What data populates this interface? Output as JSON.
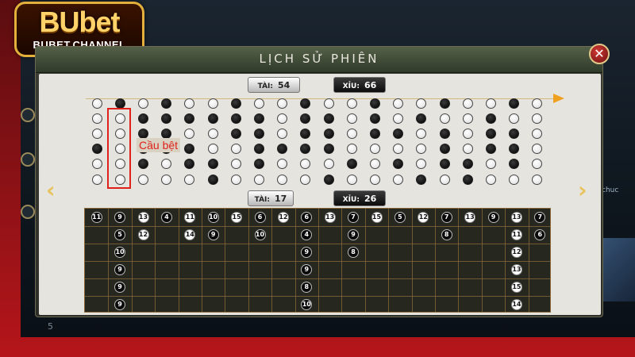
{
  "logo": {
    "main": "BUbet",
    "sub": "BUBET.CHANNEL"
  },
  "dialog": {
    "title": "LỊCH SỬ PHIÊN",
    "close_label": "✕"
  },
  "summary_top": {
    "tai_label": "TÀI:",
    "tai_count": "54",
    "xiu_label": "XỈU:",
    "xiu_count": "66"
  },
  "summary_bottom": {
    "tai_label": "TÀI:",
    "tai_count": "17",
    "xiu_label": "XỈU:",
    "xiu_count": "26"
  },
  "annotation": {
    "label": "Cầu bệt",
    "color": "#e0201a"
  },
  "nav": {
    "prev": "‹",
    "next": "›"
  },
  "footer_number": "5",
  "side_text": "chuc",
  "colors": {
    "tai": "#ffffff",
    "xiu": "#000000",
    "accent": "#f0a020",
    "highlight": "#e0201a"
  },
  "bead_road": [
    [
      "w",
      "w",
      "w",
      "b",
      "w",
      "w"
    ],
    [
      "b",
      "w",
      "w",
      "w",
      "w",
      "w"
    ],
    [
      "w",
      "b",
      "b",
      "b",
      "b",
      "w"
    ],
    [
      "b",
      "b",
      "b",
      "b",
      "w",
      "w"
    ],
    [
      "w",
      "b",
      "w",
      "b",
      "b",
      "w"
    ],
    [
      "w",
      "b",
      "w",
      "w",
      "b",
      "b"
    ],
    [
      "b",
      "b",
      "b",
      "w",
      "w",
      "w"
    ],
    [
      "w",
      "b",
      "b",
      "b",
      "b",
      "w"
    ],
    [
      "w",
      "w",
      "w",
      "b",
      "w",
      "w"
    ],
    [
      "b",
      "b",
      "b",
      "b",
      "w",
      "w"
    ],
    [
      "w",
      "b",
      "b",
      "b",
      "w",
      "b"
    ],
    [
      "w",
      "w",
      "w",
      "w",
      "b",
      "w"
    ],
    [
      "b",
      "b",
      "b",
      "w",
      "w",
      "w"
    ],
    [
      "w",
      "w",
      "b",
      "w",
      "b",
      "w"
    ],
    [
      "w",
      "b",
      "w",
      "w",
      "w",
      "b"
    ],
    [
      "b",
      "w",
      "b",
      "b",
      "b",
      "w"
    ],
    [
      "w",
      "w",
      "w",
      "w",
      "b",
      "b"
    ],
    [
      "w",
      "b",
      "b",
      "b",
      "w",
      "w"
    ],
    [
      "b",
      "w",
      "b",
      "b",
      "b",
      "w"
    ],
    [
      "w",
      "w",
      "w",
      "w",
      "w",
      "w"
    ]
  ],
  "result_road": [
    [
      {
        "v": "11",
        "c": "b"
      }
    ],
    [
      {
        "v": "9",
        "c": "b"
      },
      {
        "v": "5",
        "c": "b"
      },
      {
        "v": "10",
        "c": "b"
      },
      {
        "v": "9",
        "c": "b"
      },
      {
        "v": "9",
        "c": "b"
      },
      {
        "v": "9",
        "c": "b"
      }
    ],
    [
      {
        "v": "13",
        "c": "w"
      },
      {
        "v": "12",
        "c": "w"
      }
    ],
    [
      {
        "v": "4",
        "c": "b"
      }
    ],
    [
      {
        "v": "11",
        "c": "w"
      },
      {
        "v": "14",
        "c": "w"
      }
    ],
    [
      {
        "v": "10",
        "c": "b"
      },
      {
        "v": "9",
        "c": "b"
      }
    ],
    [
      {
        "v": "15",
        "c": "w"
      }
    ],
    [
      {
        "v": "6",
        "c": "b"
      },
      {
        "v": "10",
        "c": "b"
      }
    ],
    [
      {
        "v": "12",
        "c": "w"
      }
    ],
    [
      {
        "v": "6",
        "c": "b"
      },
      {
        "v": "4",
        "c": "b"
      },
      {
        "v": "9",
        "c": "b"
      },
      {
        "v": "9",
        "c": "b"
      },
      {
        "v": "8",
        "c": "b"
      },
      {
        "v": "10",
        "c": "b"
      }
    ],
    [
      {
        "v": "13",
        "c": "w"
      }
    ],
    [
      {
        "v": "7",
        "c": "b"
      },
      {
        "v": "9",
        "c": "b"
      },
      {
        "v": "8",
        "c": "b"
      }
    ],
    [
      {
        "v": "15",
        "c": "w"
      }
    ],
    [
      {
        "v": "5",
        "c": "b"
      }
    ],
    [
      {
        "v": "12",
        "c": "w"
      }
    ],
    [
      {
        "v": "7",
        "c": "b"
      },
      {
        "v": "8",
        "c": "b"
      }
    ],
    [
      {
        "v": "13",
        "c": "w"
      }
    ],
    [
      {
        "v": "9",
        "c": "b"
      }
    ],
    [
      {
        "v": "13",
        "c": "w"
      },
      {
        "v": "11",
        "c": "w"
      },
      {
        "v": "12",
        "c": "w"
      },
      {
        "v": "13",
        "c": "w"
      },
      {
        "v": "15",
        "c": "w"
      },
      {
        "v": "14",
        "c": "w"
      }
    ],
    [
      {
        "v": "7",
        "c": "b"
      },
      {
        "v": "6",
        "c": "b"
      }
    ]
  ]
}
